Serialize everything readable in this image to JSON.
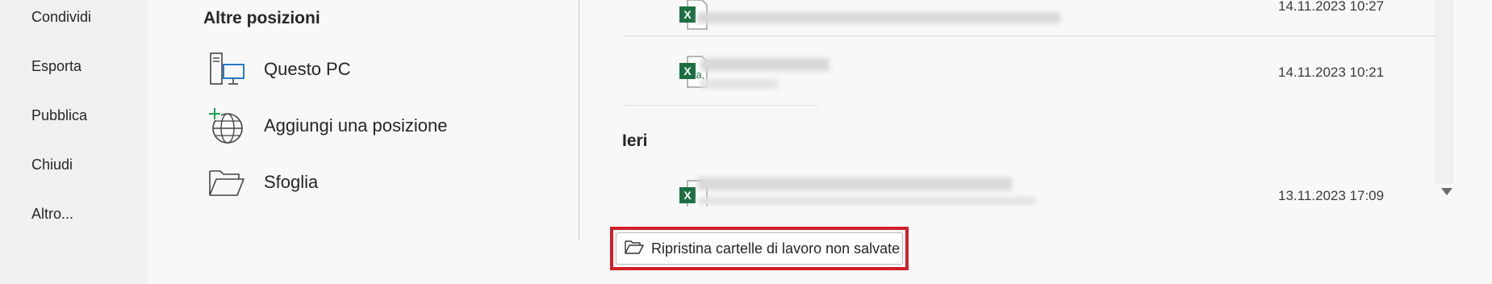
{
  "nav": {
    "items": [
      {
        "label": "Condividi"
      },
      {
        "label": "Esporta"
      },
      {
        "label": "Pubblica"
      },
      {
        "label": "Chiudi"
      },
      {
        "label": "Altro..."
      }
    ]
  },
  "locations": {
    "title": "Altre posizioni",
    "items": [
      {
        "label": "Questo PC",
        "icon": "computer-icon"
      },
      {
        "label": "Aggiungi una posizione",
        "icon": "add-globe-icon"
      },
      {
        "label": "Sfoglia",
        "icon": "folder-icon"
      }
    ]
  },
  "files": {
    "rows": [
      {
        "date": "14.11.2023 10:27",
        "icon": "excel-icon"
      },
      {
        "date": "14.11.2023 10:21",
        "icon": "excel-csv-icon"
      },
      {
        "date": "13.11.2023 17:09",
        "icon": "excel-icon"
      }
    ],
    "group_label": "Ieri"
  },
  "restore_button": {
    "label": "Ripristina cartelle di lavoro non salvate",
    "icon": "open-folder-icon"
  },
  "colors": {
    "excel_green": "#1d6f42",
    "highlight_red": "#d0202a"
  }
}
